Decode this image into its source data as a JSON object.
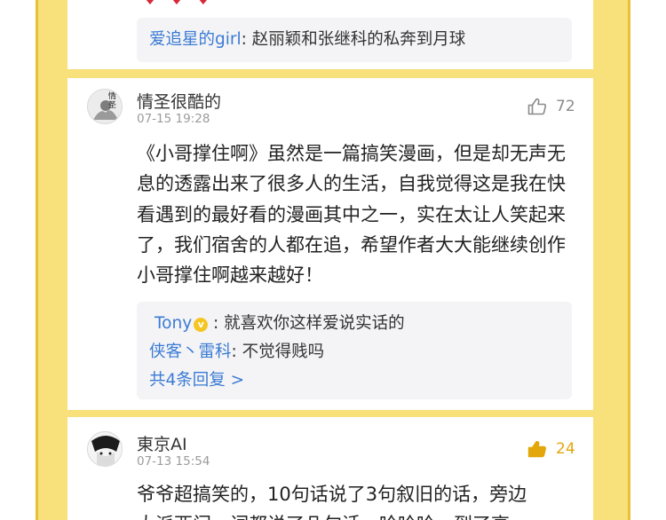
{
  "comments": [
    {
      "replies": [
        {
          "user": "爱追星的girl",
          "sep": ": ",
          "text": "赵丽颖和张继科的私奔到月球"
        }
      ]
    },
    {
      "author": "情圣很酷的",
      "avatar_text": "情圣",
      "time": "07-15 19:28",
      "likes": "72",
      "liked": false,
      "content": "《小哥撑住啊》虽然是一篇搞笑漫画，但是却无声无息的透露出来了很多人的生活，自我觉得这是我在快看遇到的最好看的漫画其中之一，实在太让人笑起来了，我们宿舍的人都在追，希望作者大大能继续创作小哥撑住啊越来越好！",
      "replies": [
        {
          "user": "Tony",
          "badge": "v",
          "sep": " : ",
          "text": "就喜欢你这样爱说实话的"
        },
        {
          "user": "侠客丶雷科",
          "sep": ": ",
          "text": "不觉得贱吗"
        }
      ],
      "more_replies": "共4条回复 >"
    },
    {
      "author": "東京AI",
      "time": "07-13 15:54",
      "likes": "24",
      "liked": true,
      "content_line1": "爷爷超搞笑的，10句话说了3句叙旧的话，旁边",
      "content_line2": "大派西门，词都说了几句话，哈哈哈，到了高"
    }
  ],
  "colors": {
    "frame": "#f8e07a",
    "username_link": "#3b7bd4",
    "liked": "#e3a70c",
    "heart": "#d7293a"
  }
}
